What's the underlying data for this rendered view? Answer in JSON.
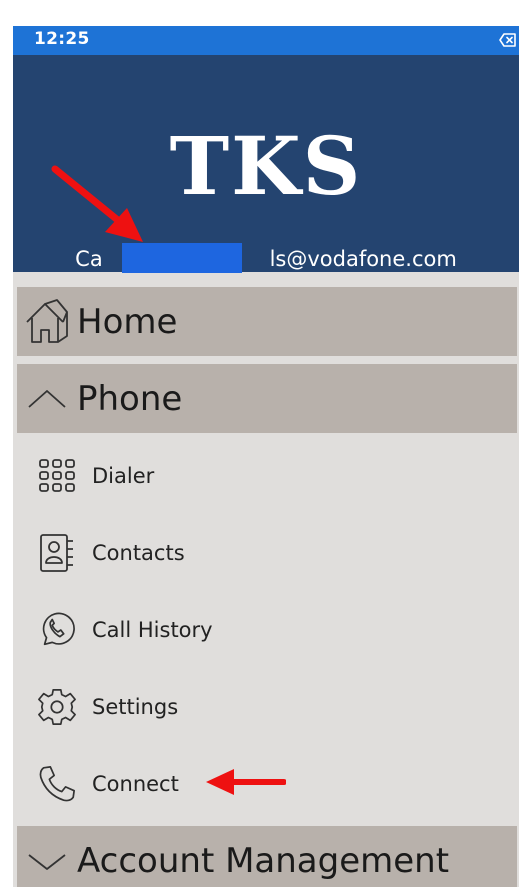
{
  "status_bar": {
    "time": "12:25",
    "icons": [
      "clear-icon"
    ]
  },
  "header": {
    "logo": "TKS",
    "email": "Ca                         ls@vodafone.com",
    "redaction_color": "#1e66e0",
    "background": "#244470"
  },
  "menu": {
    "home": {
      "label": "Home",
      "icon": "home-icon"
    },
    "phone": {
      "label": "Phone",
      "icon": "chevron-up-icon",
      "expanded": true,
      "items": [
        {
          "label": "Dialer",
          "icon": "dialpad-icon"
        },
        {
          "label": "Contacts",
          "icon": "contacts-book-icon"
        },
        {
          "label": "Call History",
          "icon": "whatsapp-phone-icon"
        },
        {
          "label": "Settings",
          "icon": "gear-icon"
        },
        {
          "label": "Connect",
          "icon": "phone-icon"
        }
      ]
    },
    "account_management": {
      "label": "Account Management",
      "icon": "chevron-down-icon",
      "expanded": false
    }
  },
  "annotations": {
    "arrow_color": "#ee1111"
  },
  "colors": {
    "status_bar": "#1e73d6",
    "menu_background": "#e0dedc",
    "menu_section": "#b8b1ab"
  }
}
